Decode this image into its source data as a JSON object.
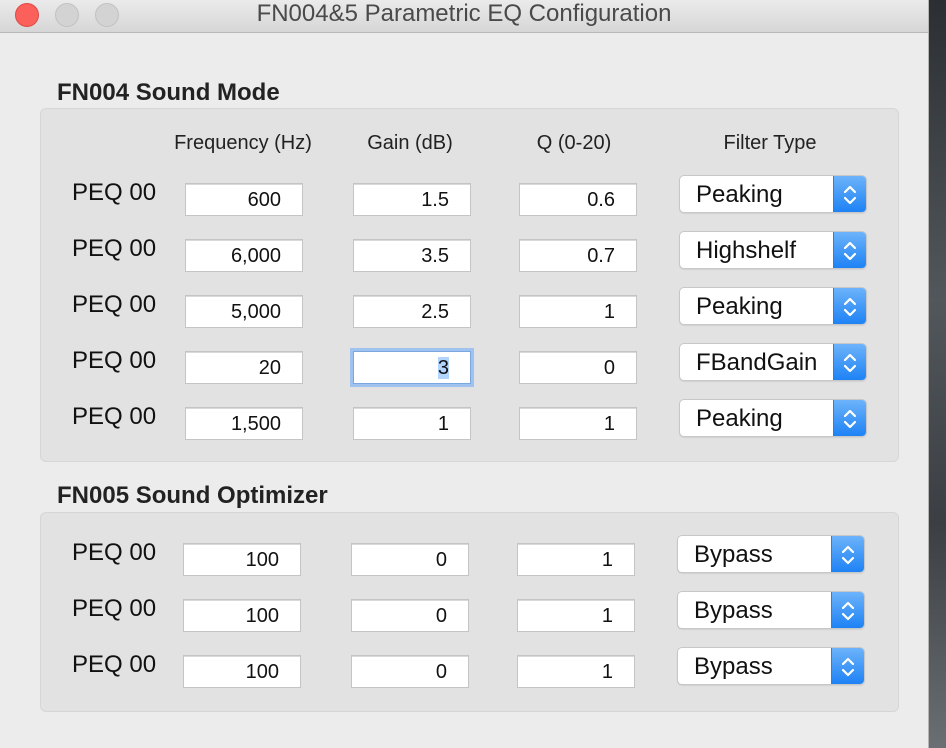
{
  "window": {
    "title": "FN004&5 Parametric EQ Configuration"
  },
  "headers": {
    "frequency": "Frequency (Hz)",
    "gain": "Gain (dB)",
    "q": "Q (0-20)",
    "filter_type": "Filter Type"
  },
  "fn004": {
    "title": "FN004 Sound Mode",
    "rows": [
      {
        "label": "PEQ 00",
        "frequency": "600",
        "gain": "1.5",
        "q": "0.6",
        "filter": "Peaking"
      },
      {
        "label": "PEQ 00",
        "frequency": "6,000",
        "gain": "3.5",
        "q": "0.7",
        "filter": "Highshelf"
      },
      {
        "label": "PEQ 00",
        "frequency": "5,000",
        "gain": "2.5",
        "q": "1",
        "filter": "Peaking"
      },
      {
        "label": "PEQ 00",
        "frequency": "20",
        "gain": "3",
        "q": "0",
        "filter": "FBandGain"
      },
      {
        "label": "PEQ 00",
        "frequency": "1,500",
        "gain": "1",
        "q": "1",
        "filter": "Peaking"
      }
    ]
  },
  "fn005": {
    "title": "FN005 Sound Optimizer",
    "rows": [
      {
        "label": "PEQ 00",
        "frequency": "100",
        "gain": "0",
        "q": "1",
        "filter": "Bypass"
      },
      {
        "label": "PEQ 00",
        "frequency": "100",
        "gain": "0",
        "q": "1",
        "filter": "Bypass"
      },
      {
        "label": "PEQ 00",
        "frequency": "100",
        "gain": "0",
        "q": "1",
        "filter": "Bypass"
      }
    ]
  },
  "focused_field": {
    "section": "fn004",
    "row": 3,
    "column": "gain"
  },
  "colors": {
    "close": "#fc605b",
    "stepper_top": "#6cb3fa",
    "stepper_bottom": "#1e82f5",
    "focus_ring": "#9fc2ef",
    "selection": "#b3d4fd"
  },
  "icons": {
    "stepper": "up-down-chevron-icon"
  }
}
